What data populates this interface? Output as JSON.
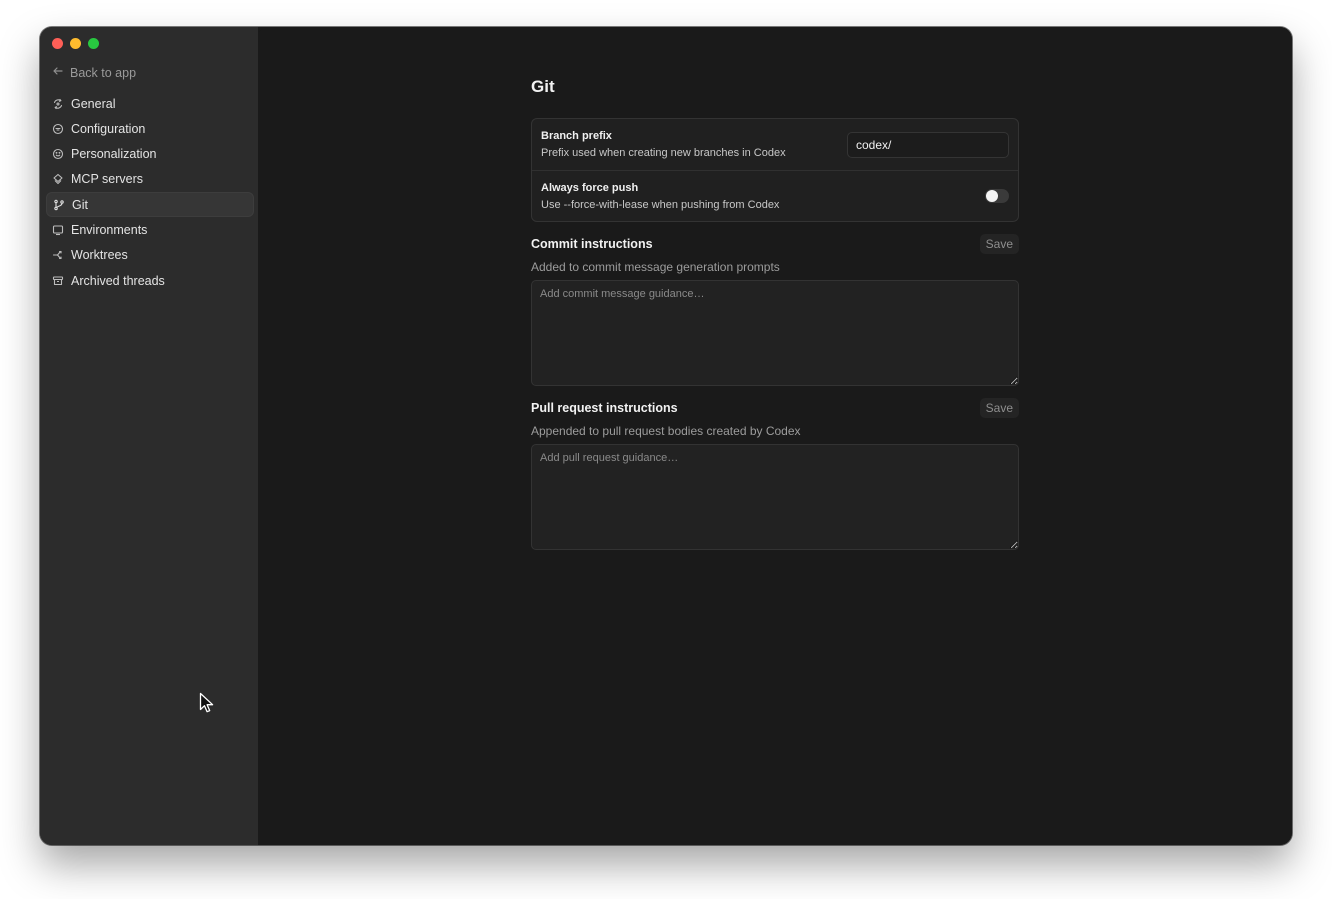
{
  "window": {
    "traffic_lights": {
      "close": "#fe5f57",
      "minimize": "#febc2e",
      "zoom": "#28c840"
    }
  },
  "sidebar": {
    "back_label": "Back to app",
    "items": [
      {
        "label": "General",
        "icon": "general-icon"
      },
      {
        "label": "Configuration",
        "icon": "configuration-icon"
      },
      {
        "label": "Personalization",
        "icon": "personalization-icon"
      },
      {
        "label": "MCP servers",
        "icon": "mcp-servers-icon"
      },
      {
        "label": "Git",
        "icon": "git-branch-icon",
        "active": true
      },
      {
        "label": "Environments",
        "icon": "environments-icon"
      },
      {
        "label": "Worktrees",
        "icon": "worktrees-icon"
      },
      {
        "label": "Archived threads",
        "icon": "archive-icon"
      }
    ]
  },
  "main": {
    "title": "Git",
    "branch_prefix": {
      "title": "Branch prefix",
      "description": "Prefix used when creating new branches in Codex",
      "value": "codex/"
    },
    "force_push": {
      "title": "Always force push",
      "description": "Use --force-with-lease when pushing from Codex",
      "enabled": false
    },
    "commit_instructions": {
      "title": "Commit instructions",
      "description": "Added to commit message generation prompts",
      "save_label": "Save",
      "placeholder": "Add commit message guidance…"
    },
    "pr_instructions": {
      "title": "Pull request instructions",
      "description": "Appended to pull request bodies created by Codex",
      "save_label": "Save",
      "placeholder": "Add pull request guidance…"
    }
  }
}
